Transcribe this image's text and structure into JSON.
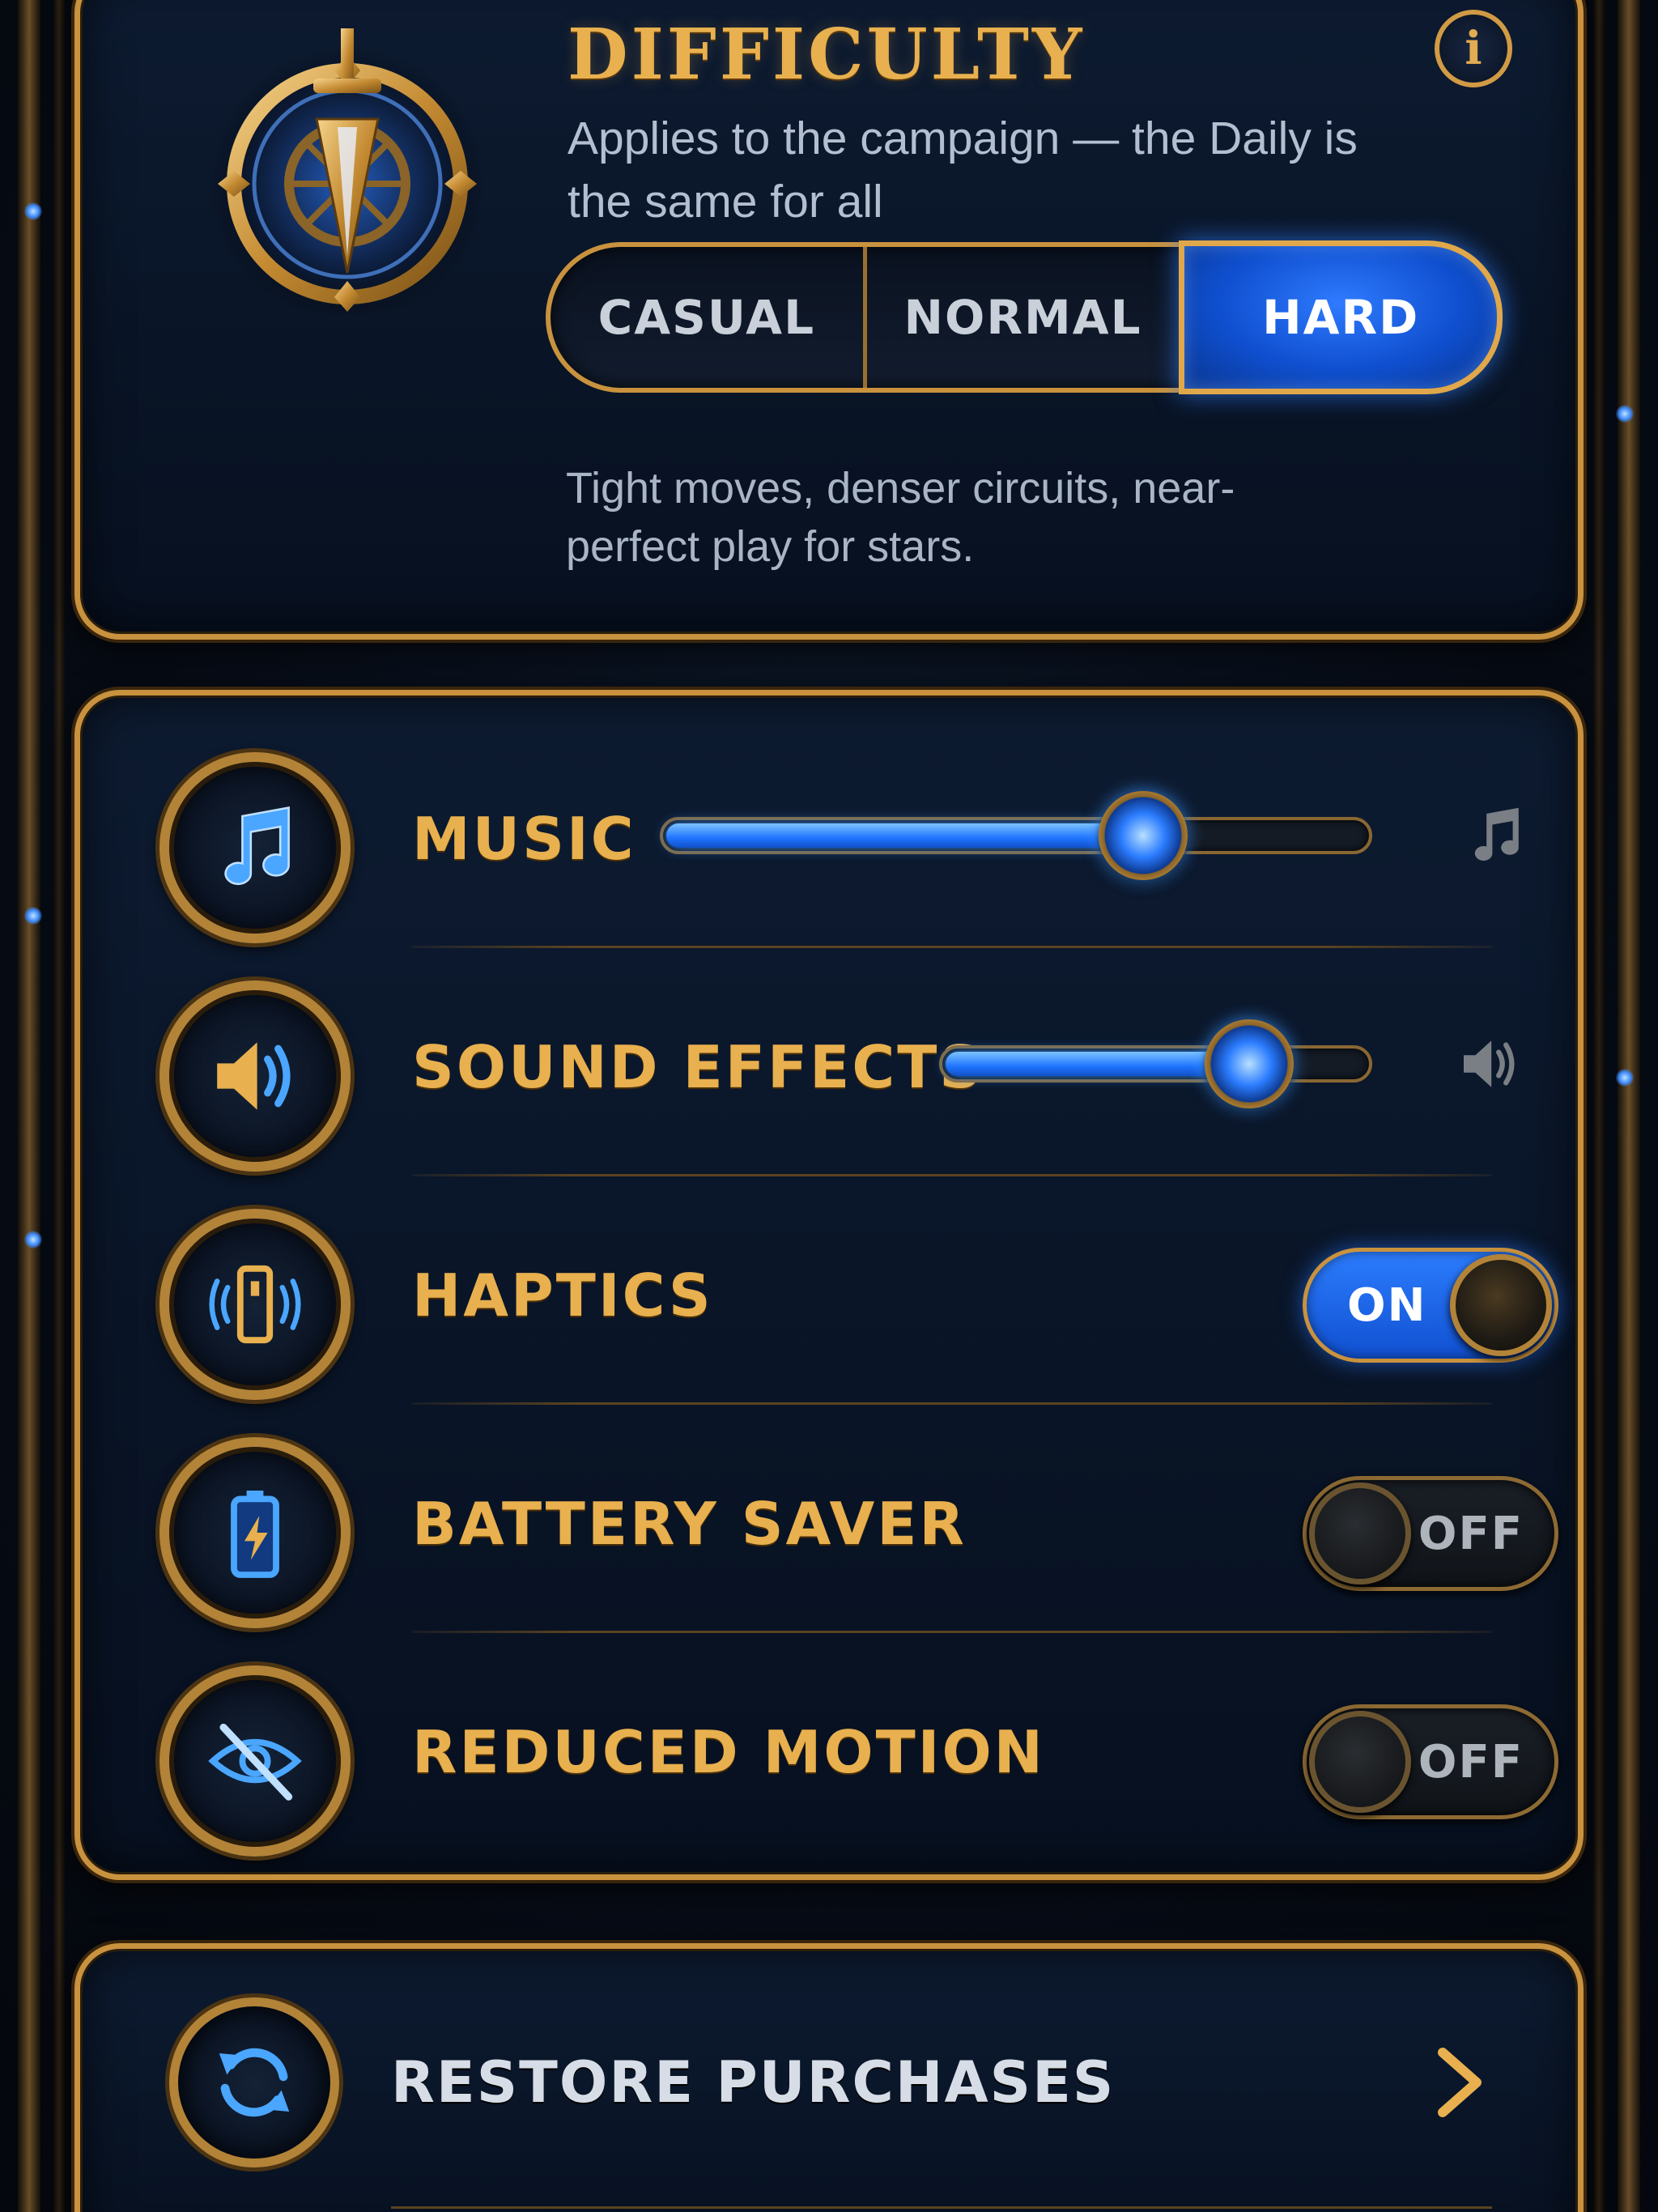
{
  "colors": {
    "gold": "#e8b04e",
    "gold_border": "#c9923e",
    "active_blue": "#1f5fe0",
    "panel_bg": "#0b1629",
    "off_text": "#aeb4bc"
  },
  "difficulty": {
    "title": "DIFFICULTY",
    "subtitle": "Applies to the campaign — the Daily is the same for all",
    "options": [
      "CASUAL",
      "NORMAL",
      "HARD"
    ],
    "selected": "HARD",
    "description": "Tight moves, denser circuits, near-perfect play for stars.",
    "info_icon": "info-icon",
    "info_glyph": "i",
    "emblem_icon": "sword-compass-emblem-icon"
  },
  "settings": {
    "rows": [
      {
        "label": "MUSIC",
        "type": "slider",
        "value": 0.68,
        "icon": "music-note-icon",
        "end_icon": "music-note-icon"
      },
      {
        "label": "SOUND EFFECTS",
        "type": "slider",
        "value": 0.72,
        "icon": "speaker-icon",
        "end_icon": "speaker-icon"
      },
      {
        "label": "HAPTICS",
        "type": "toggle",
        "state": "ON",
        "icon": "phone-vibrate-icon"
      },
      {
        "label": "BATTERY SAVER",
        "type": "toggle",
        "state": "OFF",
        "icon": "battery-charging-icon"
      },
      {
        "label": "REDUCED MOTION",
        "type": "toggle",
        "state": "OFF",
        "icon": "eye-slash-icon"
      }
    ]
  },
  "actions": {
    "restore_label": "RESTORE PURCHASES",
    "restore_icon": "refresh-icon",
    "chevron_icon": "chevron-right-icon"
  }
}
